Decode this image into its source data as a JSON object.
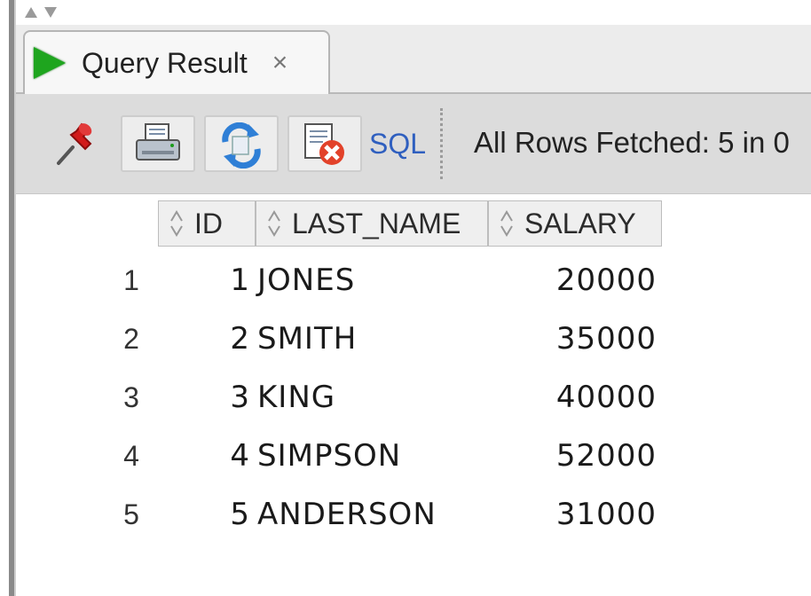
{
  "tab": {
    "label": "Query Result",
    "close_glyph": "×"
  },
  "toolbar": {
    "pin_icon": "pin-icon",
    "print_icon": "print-icon",
    "refresh_icon": "refresh-icon",
    "cancel_icon": "cancel-query-icon",
    "sql_label": "SQL",
    "status": "All Rows Fetched: 5 in 0"
  },
  "grid": {
    "columns": [
      "ID",
      "LAST_NAME",
      "SALARY"
    ],
    "rows": [
      {
        "num": "1",
        "id": "1",
        "last_name": "JONES",
        "salary": "20000"
      },
      {
        "num": "2",
        "id": "2",
        "last_name": "SMITH",
        "salary": "35000"
      },
      {
        "num": "3",
        "id": "3",
        "last_name": "KING",
        "salary": "40000"
      },
      {
        "num": "4",
        "id": "4",
        "last_name": "SIMPSON",
        "salary": "52000"
      },
      {
        "num": "5",
        "id": "5",
        "last_name": "ANDERSON",
        "salary": "31000"
      }
    ]
  },
  "colors": {
    "run_green": "#1ea51e",
    "link_blue": "#2f5fbf"
  }
}
